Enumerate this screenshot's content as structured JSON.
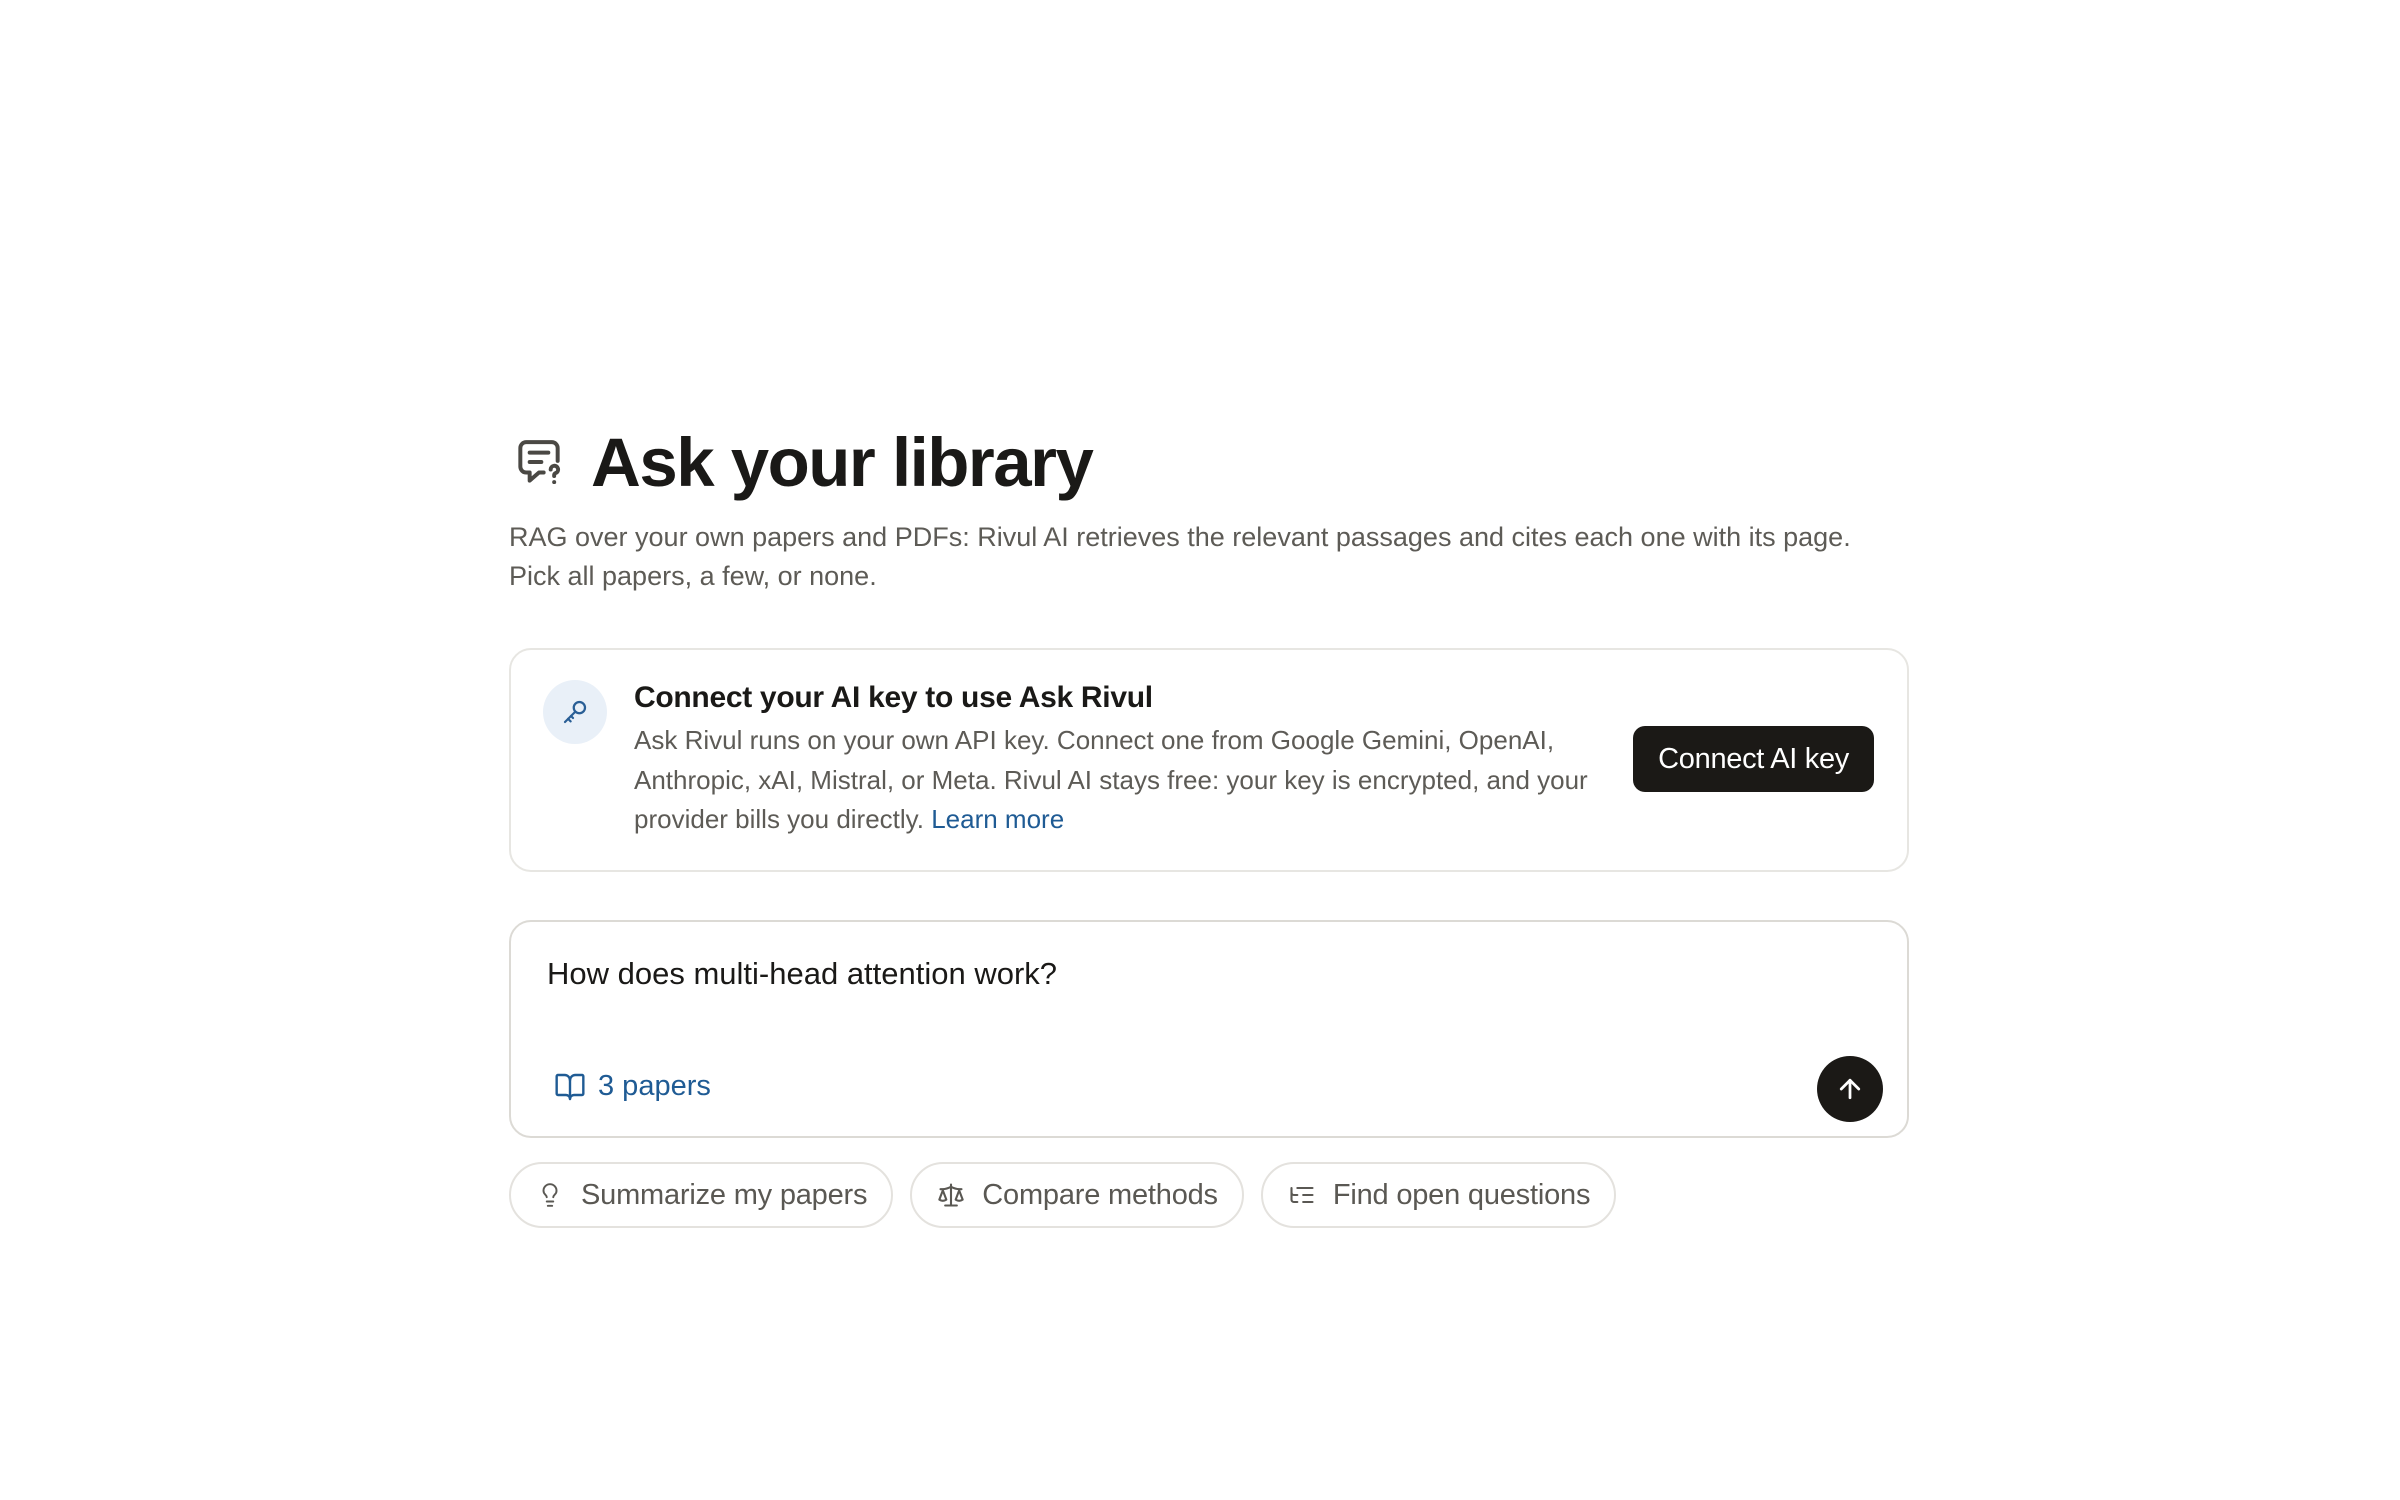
{
  "header": {
    "title": "Ask your library",
    "subtitle": "RAG over your own papers and PDFs: Rivul AI retrieves the relevant passages and cites each one with its page. Pick all papers, a few, or none.",
    "icon": "chat-question-icon"
  },
  "connect_card": {
    "icon": "key-icon",
    "title": "Connect your AI key to use Ask Rivul",
    "body": "Ask Rivul runs on your own API key. Connect one from Google Gemini, OpenAI, Anthropic, xAI, Mistral, or Meta. Rivul AI stays free: your key is encrypted, and your provider bills you directly.",
    "learn_more": "Learn more",
    "button_label": "Connect AI key"
  },
  "ask_box": {
    "question": "How does multi-head attention work?",
    "scope_icon": "book-open-icon",
    "scope_label": "3 papers",
    "send_icon": "arrow-up-icon"
  },
  "suggestions": [
    {
      "icon": "lightbulb-icon",
      "label": "Summarize my papers"
    },
    {
      "icon": "scale-icon",
      "label": "Compare methods"
    },
    {
      "icon": "list-tree-icon",
      "label": "Find open questions"
    }
  ],
  "colors": {
    "accent_link": "#1f5b94",
    "button_dark": "#1b1916",
    "badge_bg": "#e9f0f8"
  }
}
